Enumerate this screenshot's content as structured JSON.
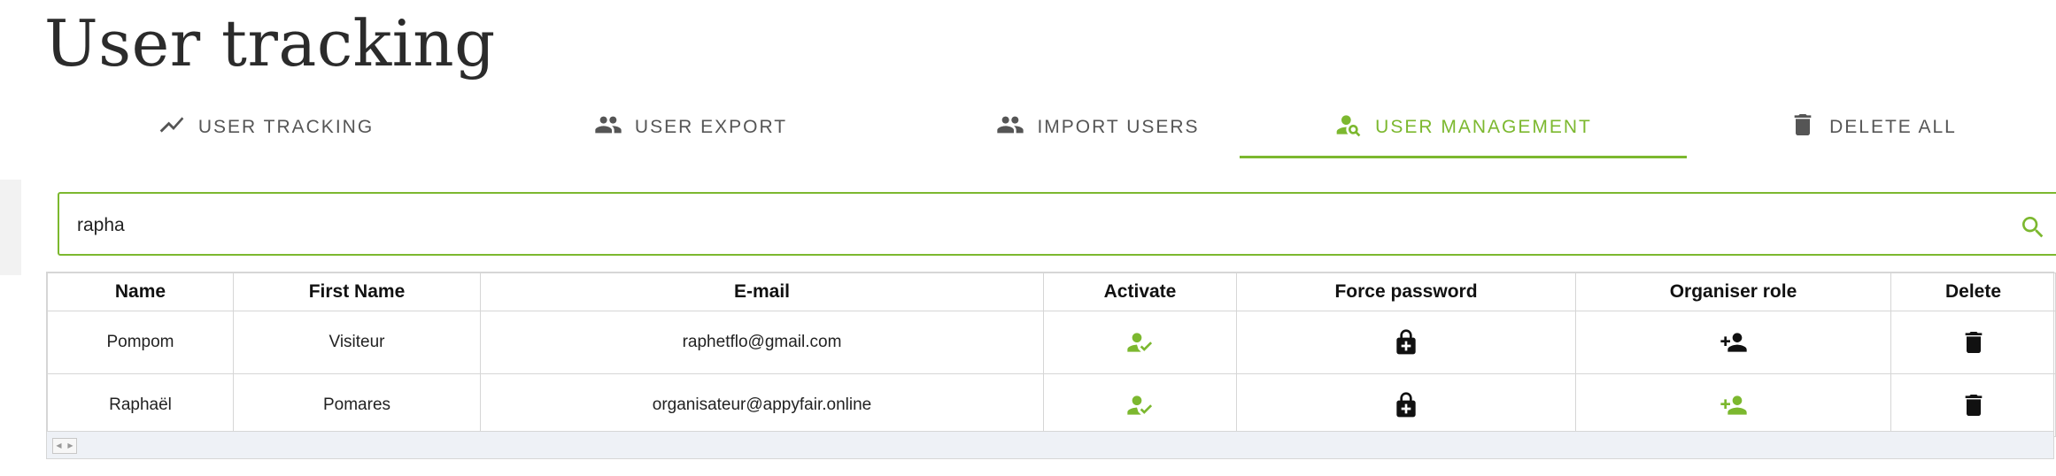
{
  "page": {
    "title": "User tracking"
  },
  "tabs": [
    {
      "label": "USER TRACKING",
      "icon": "trending-icon"
    },
    {
      "label": "USER EXPORT",
      "icon": "people-icon"
    },
    {
      "label": "IMPORT USERS",
      "icon": "people-icon"
    },
    {
      "label": "USER MANAGEMENT",
      "icon": "person-search-icon",
      "active": true
    },
    {
      "label": "DELETE ALL",
      "icon": "trash-icon"
    }
  ],
  "search": {
    "value": "rapha",
    "icon": "search-icon"
  },
  "table": {
    "headers": [
      "Name",
      "First Name",
      "E-mail",
      "Activate",
      "Force password",
      "Organiser role",
      "Delete"
    ],
    "rows": [
      {
        "name": "Pompom",
        "first_name": "Visiteur",
        "email": "raphetflo@gmail.com",
        "activate_icon": "person-check-icon",
        "activate_color": "#7cb82f",
        "force_password_icon": "lock-plus-icon",
        "organiser_icon": "person-add-icon",
        "organiser_color": "#111111",
        "delete_icon": "trash-icon"
      },
      {
        "name": "Raphaël",
        "first_name": "Pomares",
        "email": "organisateur@appyfair.online",
        "activate_icon": "person-check-icon",
        "activate_color": "#7cb82f",
        "force_password_icon": "lock-plus-icon",
        "organiser_icon": "person-add-icon",
        "organiser_color": "#7cb82f",
        "delete_icon": "trash-icon"
      }
    ]
  },
  "colors": {
    "accent": "#7cb82f",
    "text": "#222222",
    "tab_text": "#555555",
    "border": "#d6d6d6"
  }
}
